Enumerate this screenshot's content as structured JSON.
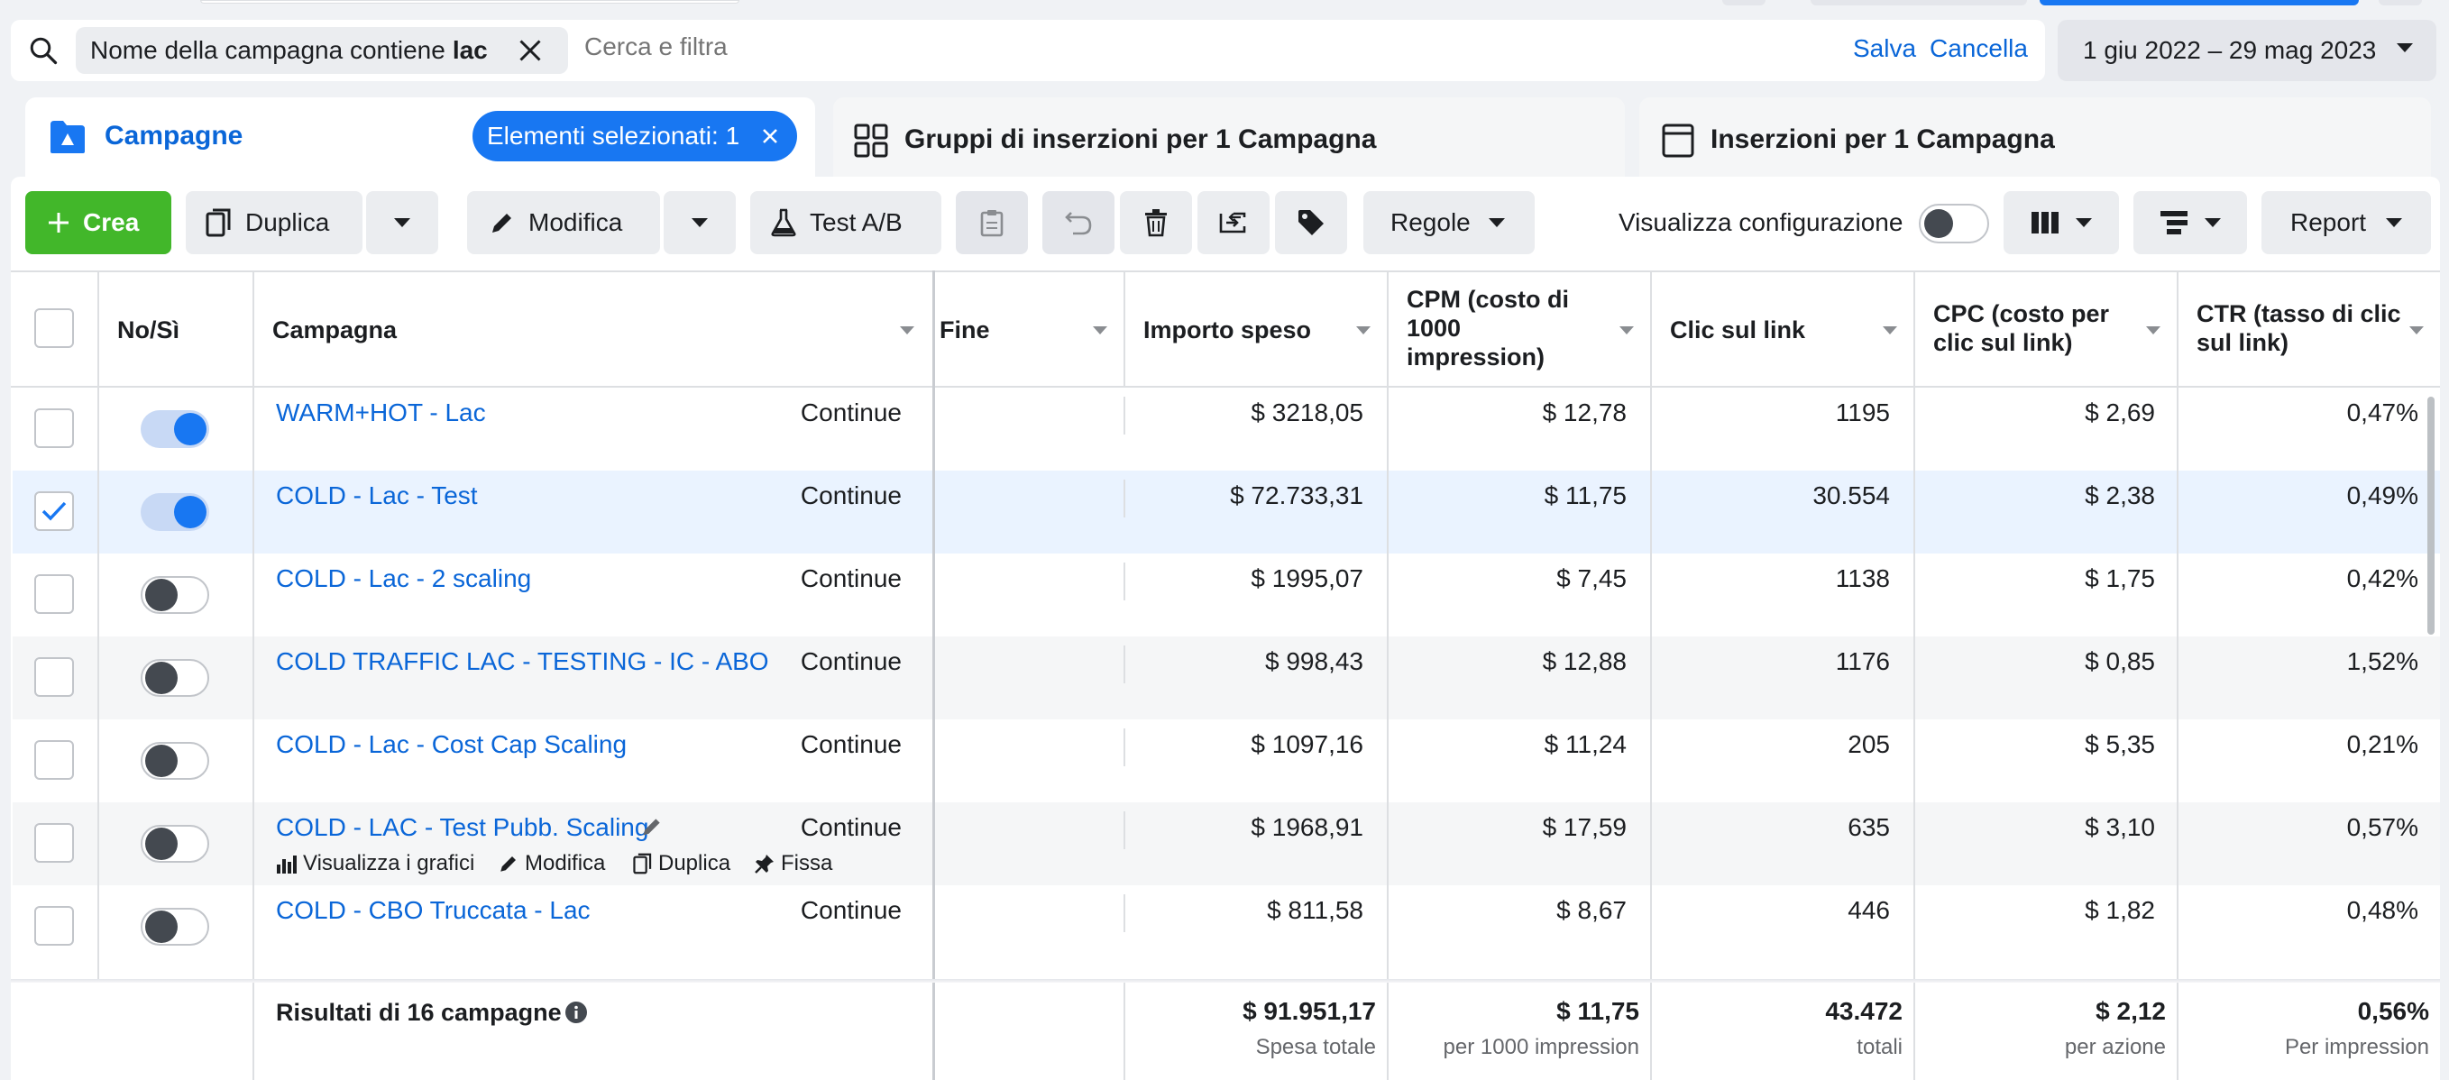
{
  "search": {
    "filter_prefix": "Nome della campagna contiene",
    "filter_value": "lac",
    "placeholder": "Cerca e filtra",
    "save_label": "Salva",
    "cancel_label": "Cancella",
    "date_range": "1 giu 2022 – 29 mag 2023"
  },
  "tabs": {
    "campaigns": "Campagne",
    "selected_badge": "Elementi selezionati: 1",
    "adsets": "Gruppi di inserzioni per 1 Campagna",
    "ads": "Inserzioni per 1 Campagna"
  },
  "toolbar": {
    "create": "Crea",
    "duplicate": "Duplica",
    "edit": "Modifica",
    "ab_test": "Test A/B",
    "rules": "Regole",
    "view_setup": "Visualizza configurazione",
    "report": "Report"
  },
  "table": {
    "headers": {
      "toggle": "No/Sì",
      "campaign": "Campagna",
      "end": "Fine",
      "spent": "Importo speso",
      "cpm": "CPM (costo di 1000 impression)",
      "clicks": "Clic sul link",
      "cpc": "CPC (costo per clic sul link)",
      "ctr": "CTR (tasso di clic sul link)"
    },
    "rows": [
      {
        "name": "WARM+HOT - Lac",
        "on": true,
        "checked": false,
        "end": "Continue",
        "spent": "$ 3218,05",
        "cpm": "$ 12,78",
        "clicks": "1195",
        "cpc": "$ 2,69",
        "ctr": "0,47%"
      },
      {
        "name": "COLD - Lac - Test",
        "on": true,
        "checked": true,
        "end": "Continue",
        "spent": "$ 72.733,31",
        "cpm": "$ 11,75",
        "clicks": "30.554",
        "cpc": "$ 2,38",
        "ctr": "0,49%"
      },
      {
        "name": "COLD - Lac - 2 scaling",
        "on": false,
        "checked": false,
        "end": "Continue",
        "spent": "$ 1995,07",
        "cpm": "$ 7,45",
        "clicks": "1138",
        "cpc": "$ 1,75",
        "ctr": "0,42%"
      },
      {
        "name": "COLD TRAFFIC LAC - TESTING - IC - ABO",
        "on": false,
        "checked": false,
        "end": "Continue",
        "spent": "$ 998,43",
        "cpm": "$ 12,88",
        "clicks": "1176",
        "cpc": "$ 0,85",
        "ctr": "1,52%"
      },
      {
        "name": "COLD - Lac - Cost Cap Scaling",
        "on": false,
        "checked": false,
        "end": "Continue",
        "spent": "$ 1097,16",
        "cpm": "$ 11,24",
        "clicks": "205",
        "cpc": "$ 5,35",
        "ctr": "0,21%"
      },
      {
        "name": "COLD - LAC - Test Pubb. Scaling",
        "on": false,
        "checked": false,
        "end": "Continue",
        "spent": "$ 1968,91",
        "cpm": "$ 17,59",
        "clicks": "635",
        "cpc": "$ 3,10",
        "ctr": "0,57%"
      },
      {
        "name": "COLD - CBO Truccata - Lac",
        "on": false,
        "checked": false,
        "end": "Continue",
        "spent": "$ 811,58",
        "cpm": "$ 8,67",
        "clicks": "446",
        "cpc": "$ 1,82",
        "ctr": "0,48%"
      }
    ],
    "row_actions": {
      "charts": "Visualizza i grafici",
      "edit": "Modifica",
      "duplicate": "Duplica",
      "pin": "Fissa"
    },
    "footer": {
      "label": "Risultati di 16 campagne",
      "spent": "$ 91.951,17",
      "spent_sub": "Spesa totale",
      "cpm": "$ 11,75",
      "cpm_sub": "per 1000 impression",
      "clicks": "43.472",
      "clicks_sub": "totali",
      "cpc": "$ 2,12",
      "cpc_sub": "per azione",
      "ctr": "0,56%",
      "ctr_sub": "Per impression"
    }
  },
  "colors": {
    "accent": "#1877f2",
    "link": "#0a66d8",
    "create_green": "#42b72a",
    "selected_row": "#eaf3ff",
    "zebra_row": "#f5f6f7"
  }
}
